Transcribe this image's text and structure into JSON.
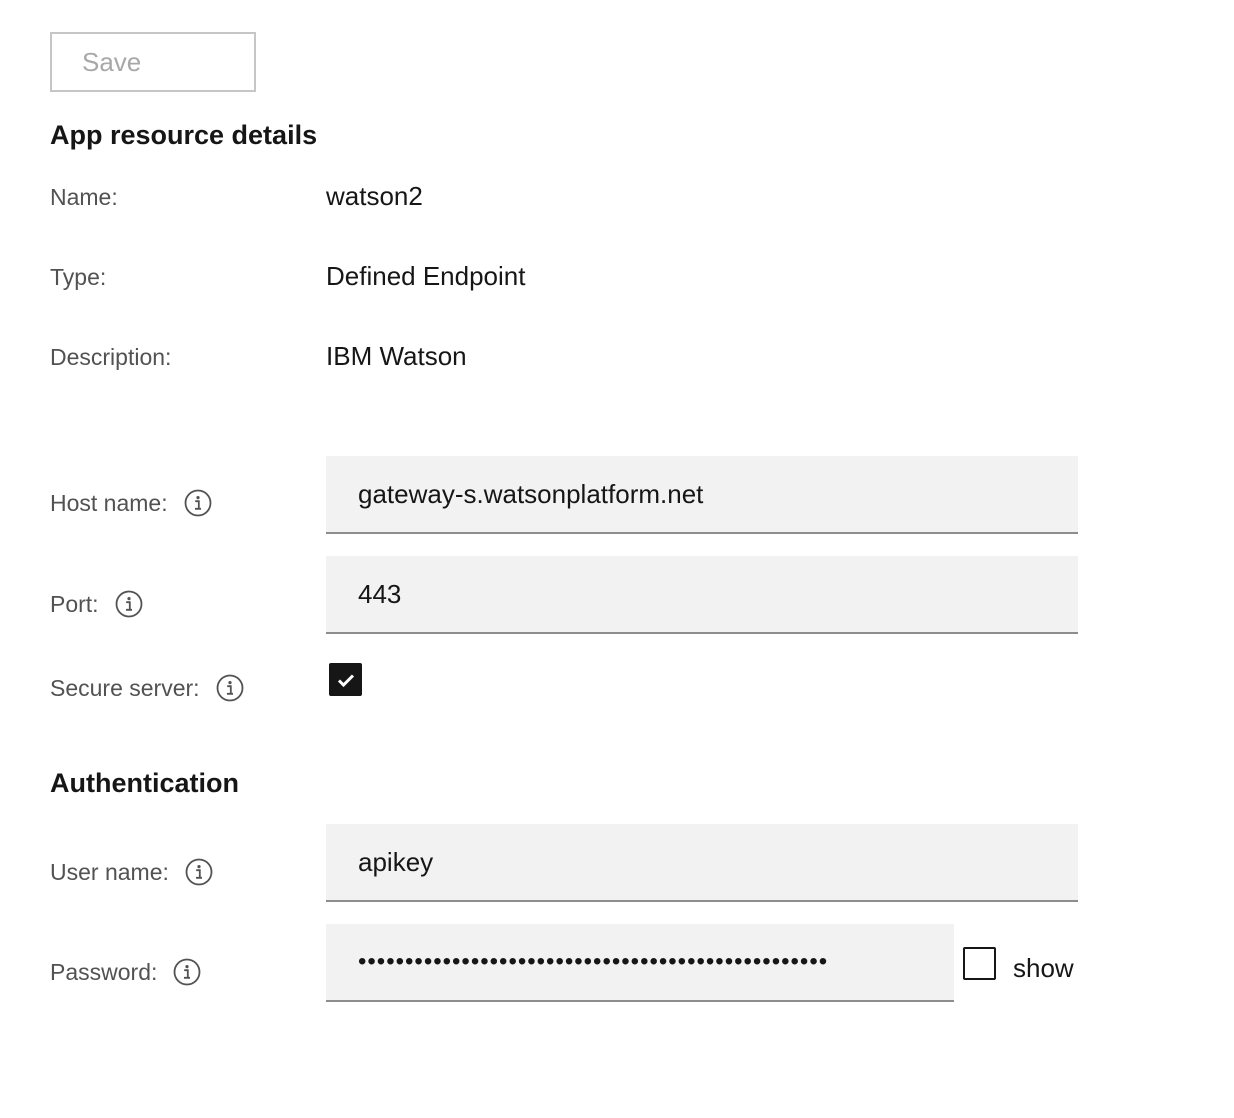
{
  "toolbar": {
    "save_label": "Save"
  },
  "details": {
    "title": "App resource details",
    "name_label": "Name:",
    "name_value": "watson2",
    "type_label": "Type:",
    "type_value": "Defined Endpoint",
    "description_label": "Description:",
    "description_value": "IBM Watson"
  },
  "connection": {
    "host_label": "Host name:",
    "host_value": "gateway-s.watsonplatform.net",
    "port_label": "Port:",
    "port_value": "443",
    "secure_label": "Secure server:",
    "secure_checked": true
  },
  "auth": {
    "title": "Authentication",
    "user_label": "User name:",
    "user_value": "apikey",
    "password_label": "Password:",
    "password_value": "••••••••••••••••••••••••••••••••••••••••••••••••••",
    "show_label": "show",
    "show_checked": false
  },
  "icons": {
    "info": "info-icon",
    "check": "checkmark-icon"
  },
  "colors": {
    "field_bg": "#f2f2f2",
    "field_border": "#8d8d8d",
    "label": "#525252",
    "text": "#161616",
    "disabled": "#a8a8a8"
  }
}
